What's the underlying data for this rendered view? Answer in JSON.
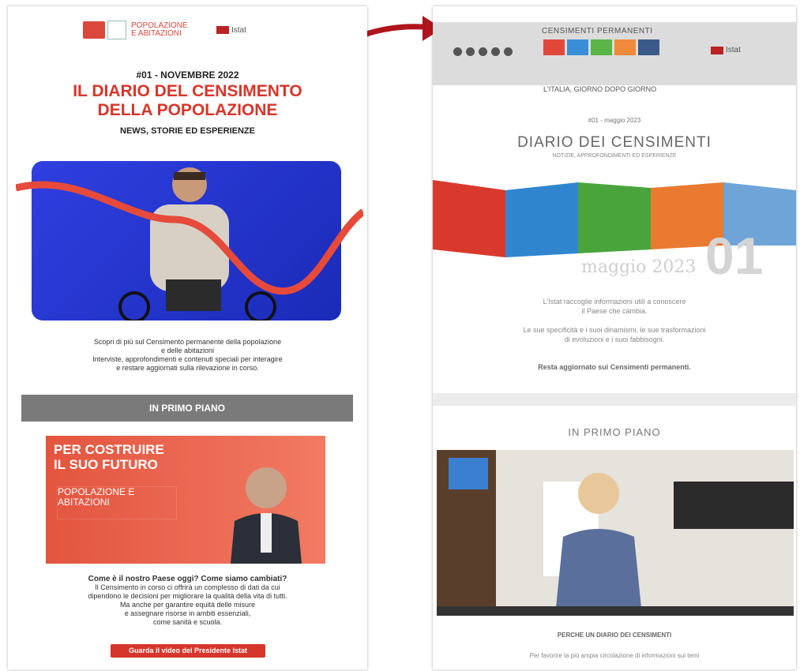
{
  "left": {
    "logo_brand": "POPOLAZIONE E ABITAZIONI",
    "istat_label": "Istat",
    "issue": "#01 - NOVEMBRE 2022",
    "title_line1": "IL DIARIO DEL CENSIMENTO",
    "title_line2": "DELLA POPOLAZIONE",
    "subtitle": "NEWS, STORIE ED ESPERIENZE",
    "intro_line1": "Scopri di più sul Censimento permanente della popolazione",
    "intro_line2": "e delle abitazioni",
    "intro_line3": "Interviste, approfondimenti e contenuti speciali per interagire",
    "intro_line4": "e restare aggiornati sulla rilevazione in corso.",
    "band_label": "IN PRIMO PIANO",
    "video_title_line1": "PER COSTRUIRE",
    "video_title_line2": "IL SUO FUTURO",
    "video_brand": "POPOLAZIONE E ABITAZIONI",
    "question": "Come è il nostro Paese oggi? Come siamo cambiati?",
    "body_line1": "Il Censimento in corso ci offrirà un complesso di dati da cui",
    "body_line2": "dipendono le decisioni per migliorare la qualità della vita di tutti.",
    "body_line3": "Ma anche per garantire equità delle misure",
    "body_line4": "e assegnare risorse in ambiti essenziali,",
    "body_line5": "come sanità e scuola.",
    "button": "Guarda il video del Presidente Istat"
  },
  "right": {
    "header_brand": "CENSIMENTI PERMANENTI",
    "header_tagline": "L'ITALIA, GIORNO DOPO GIORNO",
    "istat_label": "Istat",
    "issue": "#01 - maggio 2023",
    "title": "DIARIO DEI CENSIMENTI",
    "subtitle": "NOTIZIE, APPROFONDIMENTI ED ESPERIENZE",
    "month": "maggio 2023",
    "big_number": "01",
    "p1_line1": "L'Istat raccoglie informazioni utili a conoscere",
    "p1_line2": "il Paese che cambia.",
    "p2_line1": "Le sue specificità e i suoi dinamismi, le sue trasformazioni",
    "p2_line2": "di evoluzioni e i suoi fabbisogni.",
    "update": "Resta aggiornato sui Censimenti permanenti.",
    "primo_piano": "IN PRIMO PIANO",
    "perche": "PERCHE UN DIARIO DEI CENSIMENTI",
    "last_line": "Per favorire la più ampia circolazione di informazioni sui temi"
  },
  "colors": {
    "red": "#d6362b",
    "grey_band": "#7a7a7a",
    "hero_blue": "#2f3fe0"
  }
}
